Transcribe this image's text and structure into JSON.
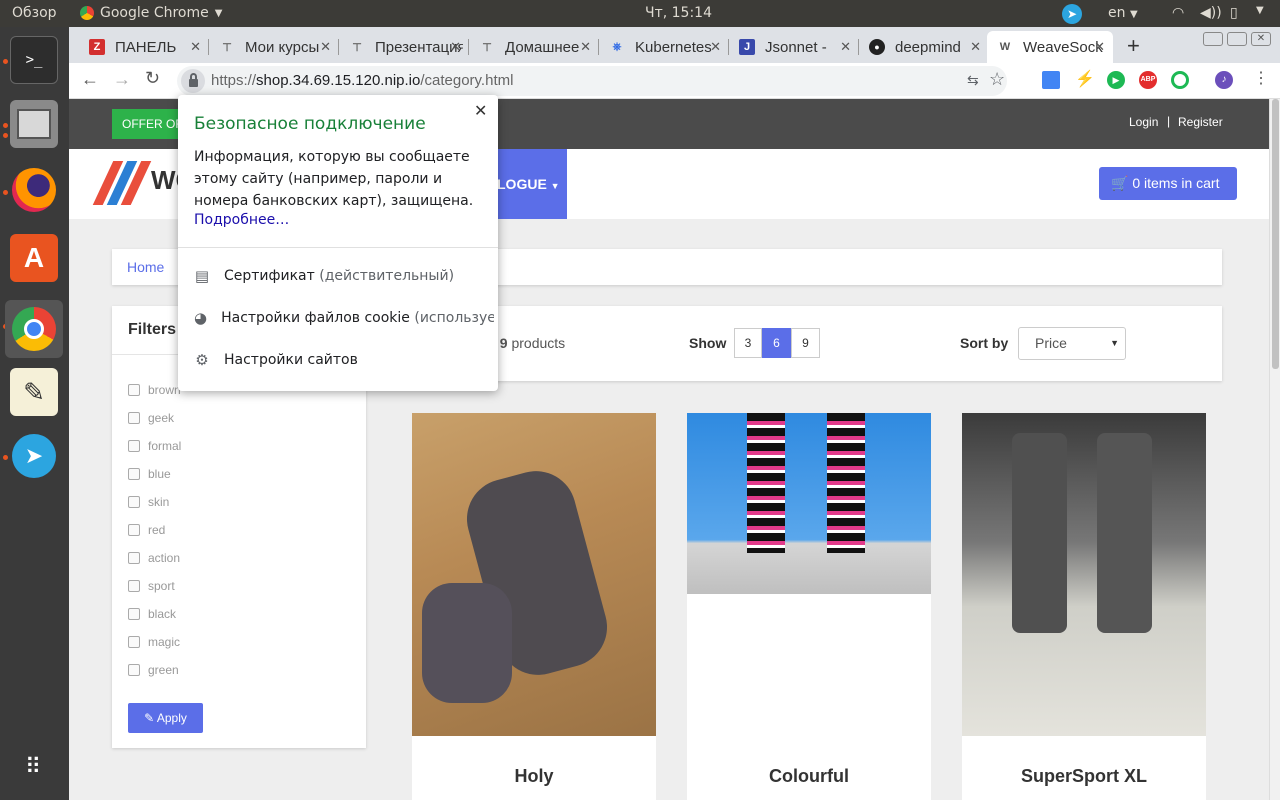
{
  "topbar": {
    "overview": "Обзор",
    "app": "Google Chrome",
    "clock": "Чт, 15:14",
    "lang": "en"
  },
  "launcher": {
    "items": [
      "terminal-icon",
      "files-icon",
      "firefox-icon",
      "software-center-icon",
      "chrome-icon",
      "text-editor-icon",
      "telegram-icon",
      "apps-grid-icon"
    ]
  },
  "tabs": [
    {
      "title": "ПАНЕЛЬ",
      "icon": "Z",
      "color": "#d32f2f"
    },
    {
      "title": "Мои курсы",
      "icon": "⊤",
      "color": "#666"
    },
    {
      "title": "Презентация",
      "icon": "⊤",
      "color": "#666"
    },
    {
      "title": "Домашнее",
      "icon": "⊤",
      "color": "#666"
    },
    {
      "title": "Kubernetes",
      "icon": "⎈",
      "color": "#326ce5"
    },
    {
      "title": "Jsonnet - ",
      "icon": "J",
      "color": "#3949ab"
    },
    {
      "title": "deepmind",
      "icon": "●",
      "color": "#222"
    },
    {
      "title": "WeaveSocks",
      "icon": "W",
      "color": "#555"
    }
  ],
  "omnibox": {
    "scheme": "https://",
    "host": "shop.34.69.15.120.nip.io",
    "path": "/category.html"
  },
  "site": {
    "offer": "OFFER OF",
    "login": "Login",
    "register": "Register",
    "logo_text": "WC",
    "catalogue": "LOGUE",
    "cart": "0 items in cart",
    "breadcrumb_home": "Home",
    "filters_title": "Filters",
    "filters": [
      "brown",
      "geek",
      "formal",
      "blue",
      "skin",
      "red",
      "action",
      "sport",
      "black",
      "magic",
      "green"
    ],
    "apply": "Apply",
    "showing_prefix": "f",
    "showing_count": "9",
    "showing_suffix": "products",
    "show_label": "Show",
    "show_options": [
      "3",
      "6",
      "9"
    ],
    "show_selected": "6",
    "sort_label": "Sort by",
    "sort_value": "Price",
    "products": [
      "Holy",
      "Colourful",
      "SuperSport XL"
    ]
  },
  "popup": {
    "title": "Безопасное подключение",
    "body": "Информация, которую вы сообщаете этому сайту (например, пароли и номера банковских карт), защищена.",
    "more": "Подробнее…",
    "cert": "Сертификат",
    "cert_status": "(действительный)",
    "cookies": "Настройки файлов cookie",
    "cookies_status": "(используется)",
    "site_settings": "Настройки сайтов"
  },
  "colors": {
    "accent": "#5b6ee8",
    "secure_green": "#188038",
    "offer_green": "#2db24a"
  }
}
